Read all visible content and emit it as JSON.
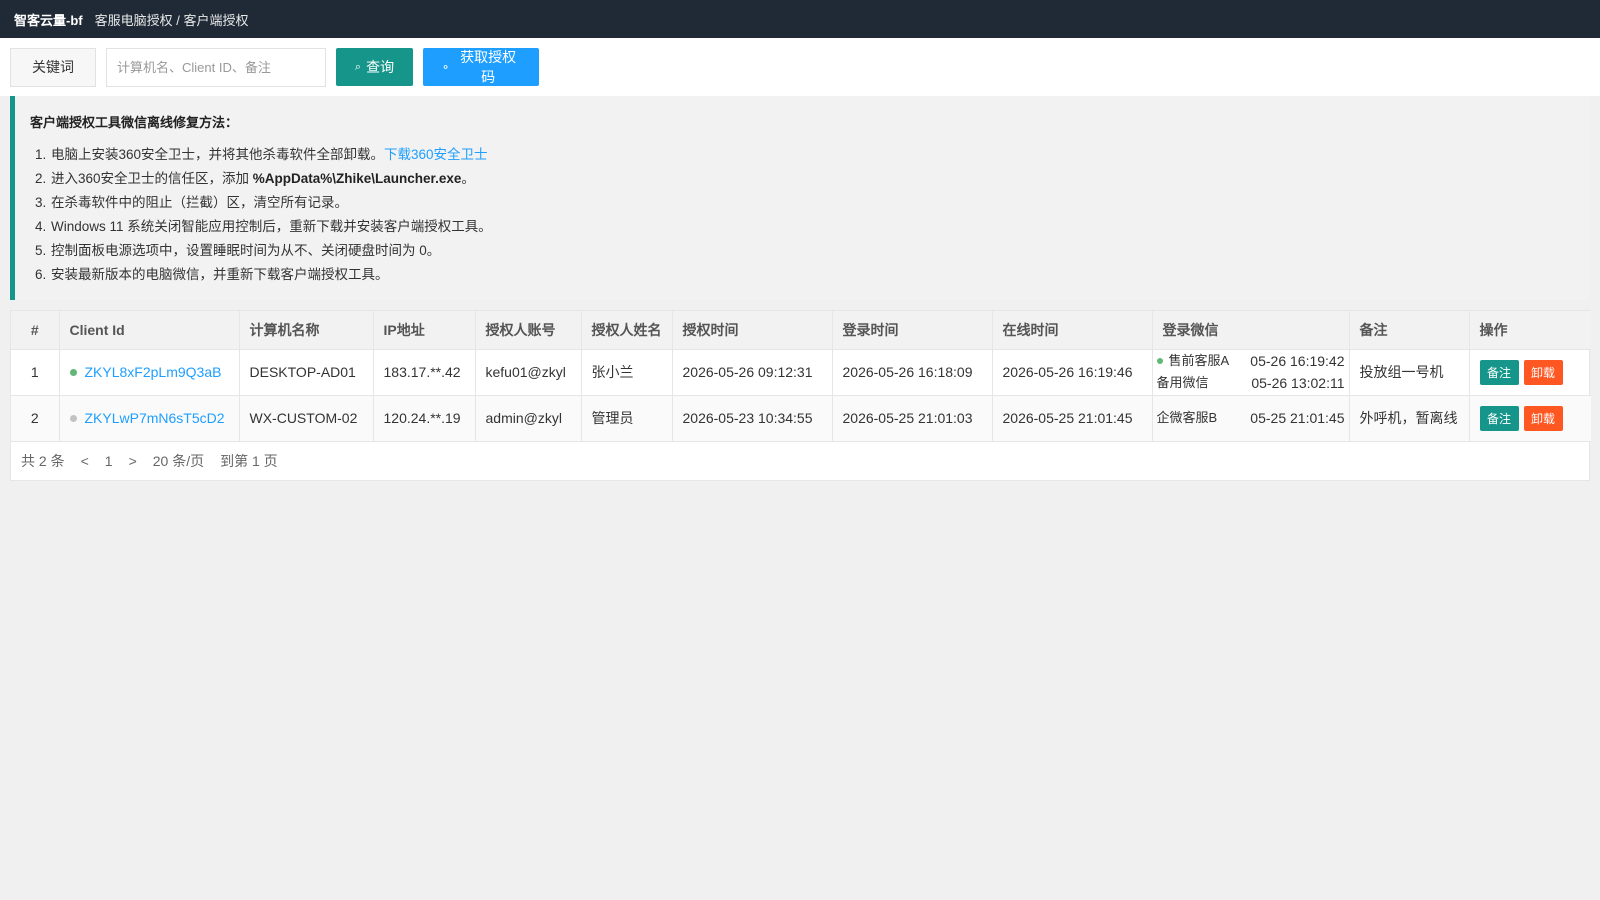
{
  "topbar": {
    "app_name": "智客云量-bf",
    "breadcrumb": "客服电脑授权 / 客户端授权"
  },
  "search": {
    "label": "关键词",
    "placeholder": "计算机名、Client ID、备注",
    "query_label": "查询",
    "query_icon": "search-icon",
    "get_code_label": "获取授权码",
    "get_code_icon": "dot-icon"
  },
  "notice": {
    "title": "客户端授权工具微信离线修复方法：",
    "items": [
      {
        "num": "1.",
        "text": "电脑上安装360安全卫士，并将其他杀毒软件全部卸载。",
        "link": "下载360安全卫士"
      },
      {
        "num": "2.",
        "text": "进入360安全卫士的信任区，添加 ",
        "bold": "%AppData%\\Zhike\\Launcher.exe",
        "tail": "。"
      },
      {
        "num": "3.",
        "text": "在杀毒软件中的阻止（拦截）区，清空所有记录。"
      },
      {
        "num": "4.",
        "text": "Windows 11 系统关闭智能应用控制后，重新下载并安装客户端授权工具。"
      },
      {
        "num": "5.",
        "text": "控制面板电源选项中，设置睡眠时间为从不、关闭硬盘时间为 0。"
      },
      {
        "num": "6.",
        "text": "安装最新版本的电脑微信，并重新下载客户端授权工具。"
      }
    ],
    "accent_color": "#16968a"
  },
  "table": {
    "headers": [
      "#",
      "Client Id",
      "计算机名称",
      "IP地址",
      "授权人账号",
      "授权人姓名",
      "授权时间",
      "登录时间",
      "在线时间",
      "登录微信",
      "备注",
      "操作"
    ],
    "rows": [
      {
        "idx": "1",
        "client_id": "ZKYL8xF2pLm9Q3aB",
        "online": true,
        "computer": "DESKTOP-AD01",
        "ip": "183.17.**.42",
        "account": "kefu01@zkyl",
        "name": "张小兰",
        "auth_time": "2026-05-26 09:12:31",
        "login_time": "2026-05-26 16:18:09",
        "online_time": "2026-05-26 16:19:46",
        "wx": [
          {
            "name": "售前客服A",
            "time": "05-26 16:19:42",
            "online": true
          },
          {
            "name": "备用微信",
            "time": "05-26 13:02:11",
            "online": false
          }
        ],
        "note": "投放组一号机",
        "op_note": "备注",
        "op_unload": "卸载"
      },
      {
        "idx": "2",
        "client_id": "ZKYLwP7mN6sT5cD2",
        "online": false,
        "computer": "WX-CUSTOM-02",
        "ip": "120.24.**.19",
        "account": "admin@zkyl",
        "name": "管理员",
        "auth_time": "2026-05-23 10:34:55",
        "login_time": "2026-05-25 21:01:03",
        "online_time": "2026-05-25 21:01:45",
        "wx": [
          {
            "name": "企微客服B",
            "time": "05-25 21:01:45",
            "online": false
          }
        ],
        "note": "外呼机，暂离线",
        "op_note": "备注",
        "op_unload": "卸载"
      }
    ]
  },
  "pager": {
    "total": "共 2 条",
    "prev": "<",
    "page": "1",
    "next": ">",
    "per_page": "20 条/页",
    "goto": "到第 1 页"
  },
  "colors": {
    "primary": "#16968a",
    "blue": "#1e9fff",
    "danger": "#ff5722",
    "topbar": "#1f2a36",
    "online": "#5fb878"
  }
}
